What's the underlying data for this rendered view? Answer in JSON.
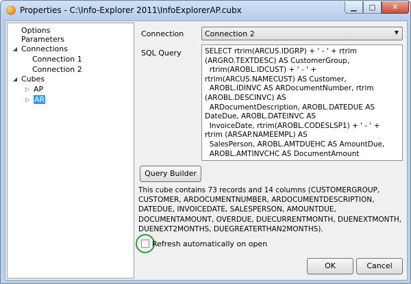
{
  "window": {
    "title": "Properties - C:\\Info-Explorer 2011\\InfoExplorerAP.cubx",
    "min_glyph": "▁",
    "max_glyph": "▢",
    "close_glyph": "✕"
  },
  "tree": {
    "options": "Options",
    "parameters": "Parameters",
    "connections": "Connections",
    "connection1": "Connection 1",
    "connection2": "Connection 2",
    "cubes": "Cubes",
    "ap": "AP",
    "ar": "AR"
  },
  "form": {
    "connection_label": "Connection",
    "connection_value": "Connection 2",
    "sql_label": "SQL Query",
    "sql_text": "SELECT rtrim(ARCUS.IDGRP) + ' - ' + rtrim (ARGRO.TEXTDESC) AS CustomerGroup,\n  rtrim(AROBL.IDCUST) + ' - ' + rtrim(ARCUS.NAMECUST) AS Customer,\n  AROBL.IDINVC AS ARDocumentNumber, rtrim (AROBL.DESCINVC) AS\n  ARDocumentDescription, AROBL.DATEDUE AS DateDue, AROBL.DATEINVC AS\n  InvoiceDate, rtrim(AROBL.CODESLSP1) + ' - ' + rtrim (ARSAP.NAMEEMPL) AS\n  SalesPerson, AROBL.AMTDUEHC AS AmountDue,\n  AROBL.AMTINVCHC AS DocumentAmount",
    "query_builder": "Query Builder",
    "description": "This cube contains 73 records and 14 columns (CUSTOMERGROUP, CUSTOMER, ARDOCUMENTNUMBER, ARDOCUMENTDESCRIPTION, DATEDUE, INVOICEDATE, SALESPERSON, AMOUNTDUE, DOCUMENTAMOUNT, OVERDUE, DUECURRENTMONTH, DUENEXTMONTH, DUENEXT2MONTHS, DUEGREATERTHAN2MONTHS).",
    "refresh_label": "Refresh automatically on open",
    "ok": "OK",
    "cancel": "Cancel"
  }
}
